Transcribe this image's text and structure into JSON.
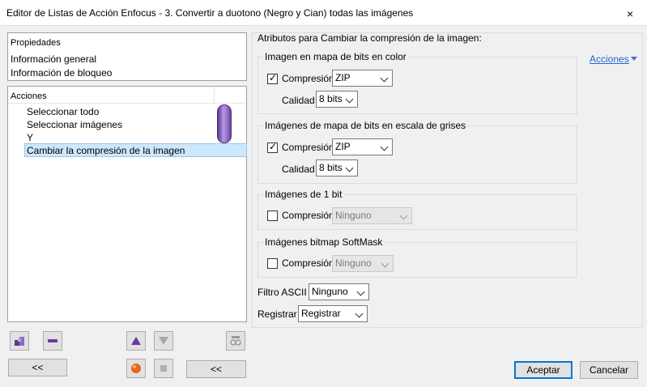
{
  "window": {
    "title": "Editor de Listas de Acción Enfocus - 3. Convertir a duotono (Negro y Cian) todas las imágenes",
    "close_glyph": "×"
  },
  "properties_panel": {
    "header": "Propiedades",
    "items": [
      "Información general",
      "Información de bloqueo"
    ]
  },
  "actions_panel": {
    "header": "Acciones",
    "items": [
      "Seleccionar todo",
      "Seleccionar imágenes",
      "Y",
      "Cambiar la compresión de la imagen"
    ],
    "selected_index": 3
  },
  "left_toolbar": {
    "collapse_label": "<<",
    "collapse_label_2": "<<",
    "icons": [
      "add-action-icon",
      "remove-action-icon",
      "move-up-icon",
      "move-down-icon",
      "glasses-icon",
      "record-icon",
      "stop-icon"
    ]
  },
  "attributes": {
    "title": "Atributos para Cambiar la compresión de la imagen:",
    "acciones_link": "Acciones",
    "color_bitmap": {
      "label": "Imagen en mapa de bits en color",
      "compression_label": "Compresión",
      "compression_checked": true,
      "compression_value": "ZIP",
      "quality_label": "Calidad",
      "quality_value": "8 bits"
    },
    "gray_bitmap": {
      "label": "Imágenes de mapa de bits en escala de grises",
      "compression_label": "Compresión",
      "compression_checked": true,
      "compression_value": "ZIP",
      "quality_label": "Calidad",
      "quality_value": "8 bits"
    },
    "one_bit": {
      "label": "Imágenes de 1 bit",
      "compression_label": "Compresión",
      "compression_checked": false,
      "compression_value": "Ninguno"
    },
    "softmask": {
      "label": "Imágenes bitmap SoftMask",
      "compression_label": "Compresión",
      "compression_checked": false,
      "compression_value": "Ninguno"
    },
    "ascii_filter": {
      "label": "Filtro ASCII",
      "value": "Ninguno"
    },
    "register": {
      "label": "Registrar",
      "value": "Registrar"
    }
  },
  "dialog_buttons": {
    "ok": "Aceptar",
    "cancel": "Cancelar"
  },
  "colors": {
    "accent": "#0078d7",
    "selection": "#cce8ff",
    "link": "#2266cc",
    "pill": "#8a6ac8"
  }
}
